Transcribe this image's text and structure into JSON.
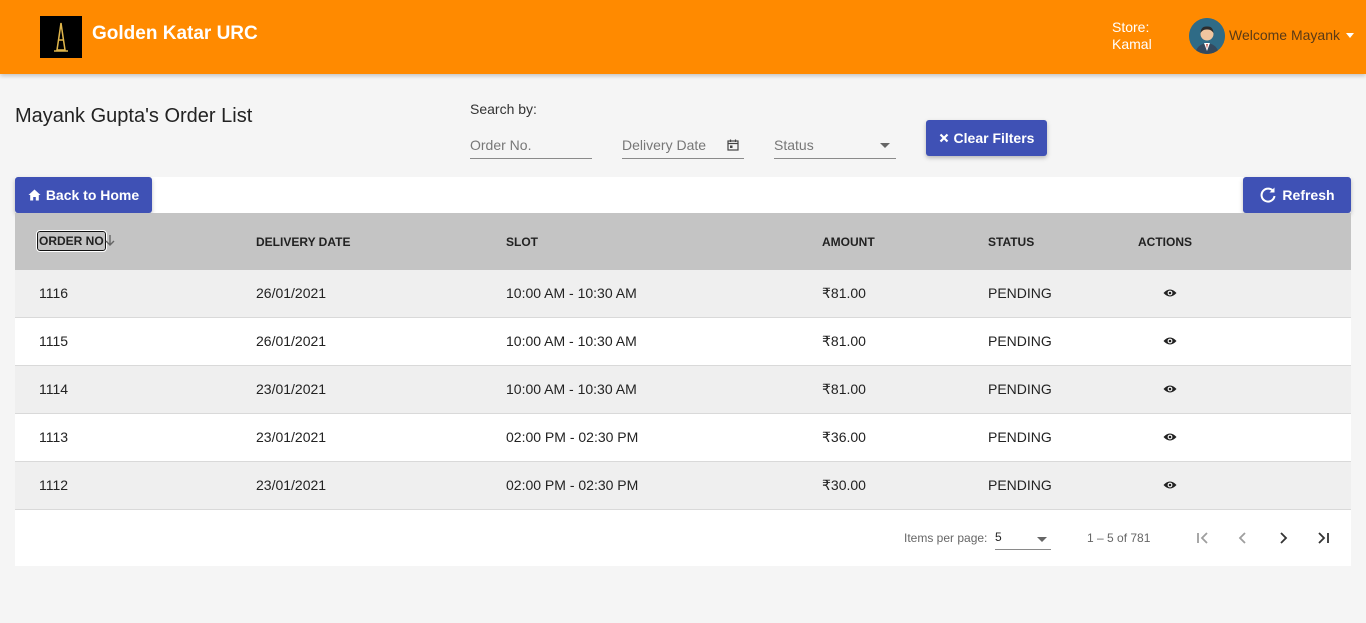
{
  "header": {
    "brand": "Golden Katar URC",
    "store_label": "Store:",
    "store_name": "Kamal",
    "welcome": "Welcome Mayank"
  },
  "page": {
    "title": "Mayank Gupta's Order List",
    "search_by": "Search by:"
  },
  "filters": {
    "order_no_placeholder": "Order No.",
    "delivery_date_placeholder": "Delivery Date",
    "status_placeholder": "Status",
    "clear_label": "Clear Filters"
  },
  "toolbar": {
    "back_label": "Back to Home",
    "refresh_label": "Refresh"
  },
  "table": {
    "columns": [
      "ORDER NO",
      "DELIVERY DATE",
      "SLOT",
      "AMOUNT",
      "STATUS",
      "ACTIONS"
    ],
    "rows": [
      {
        "order_no": "1116",
        "delivery_date": "26/01/2021",
        "slot": "10:00 AM - 10:30 AM",
        "amount": "₹81.00",
        "status": "PENDING"
      },
      {
        "order_no": "1115",
        "delivery_date": "26/01/2021",
        "slot": "10:00 AM - 10:30 AM",
        "amount": "₹81.00",
        "status": "PENDING"
      },
      {
        "order_no": "1114",
        "delivery_date": "23/01/2021",
        "slot": "10:00 AM - 10:30 AM",
        "amount": "₹81.00",
        "status": "PENDING"
      },
      {
        "order_no": "1113",
        "delivery_date": "23/01/2021",
        "slot": "02:00 PM - 02:30 PM",
        "amount": "₹36.00",
        "status": "PENDING"
      },
      {
        "order_no": "1112",
        "delivery_date": "23/01/2021",
        "slot": "02:00 PM - 02:30 PM",
        "amount": "₹30.00",
        "status": "PENDING"
      }
    ]
  },
  "paginator": {
    "items_per_page_label": "Items per page:",
    "items_per_page": "5",
    "range": "1 – 5 of 781"
  },
  "colors": {
    "header_bg": "#ff8a00",
    "primary": "#3f51b5",
    "table_head": "#c4c4c4"
  },
  "icons": {
    "clear": "close-icon",
    "back": "home-icon",
    "refresh": "refresh-icon",
    "view": "eye-icon",
    "calendar": "calendar-icon",
    "sort": "arrow-down-icon"
  }
}
